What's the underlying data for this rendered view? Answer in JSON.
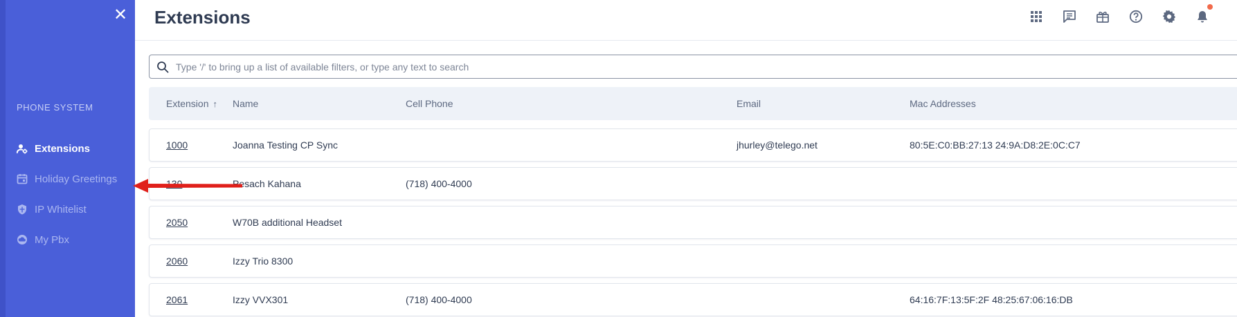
{
  "sidebar": {
    "close_glyph": "✕",
    "section_label": "PHONE SYSTEM",
    "items": [
      {
        "label": "Extensions",
        "icon": "person-gear-icon",
        "active": true
      },
      {
        "label": "Holiday Greetings",
        "icon": "calendar-icon",
        "active": false
      },
      {
        "label": "IP Whitelist",
        "icon": "shield-icon",
        "active": false
      },
      {
        "label": "My Pbx",
        "icon": "cloud-icon",
        "active": false
      }
    ]
  },
  "header": {
    "title": "Extensions",
    "icons": [
      "apps-grid-icon",
      "chat-icon",
      "gift-icon",
      "help-icon",
      "gear-icon",
      "bell-icon"
    ]
  },
  "search": {
    "placeholder": "Type '/' to bring up a list of available filters, or type any text to search",
    "value": ""
  },
  "table": {
    "columns": [
      "Extension",
      "Name",
      "Cell Phone",
      "Email",
      "Mac Addresses"
    ],
    "sort_indicator": "↑",
    "rows": [
      {
        "extension": "1000",
        "name": "Joanna Testing CP Sync",
        "cell_phone": "",
        "email": "jhurley@telego.net",
        "mac": "80:5E:C0:BB:27:13 24:9A:D8:2E:0C:C7"
      },
      {
        "extension": "130",
        "name": "Pesach Kahana",
        "cell_phone": "(718) 400-4000",
        "email": "",
        "mac": ""
      },
      {
        "extension": "2050",
        "name": "W70B additional Headset",
        "cell_phone": "",
        "email": "",
        "mac": ""
      },
      {
        "extension": "2060",
        "name": "Izzy Trio 8300",
        "cell_phone": "",
        "email": "",
        "mac": ""
      },
      {
        "extension": "2061",
        "name": "Izzy VVX301",
        "cell_phone": "(718) 400-4000",
        "email": "",
        "mac": "64:16:7F:13:5F:2F 48:25:67:06:16:DB"
      }
    ]
  },
  "colors": {
    "sidebar_bg": "#4a5fd9",
    "accent_red": "#e0201b",
    "notification_dot": "#f26a4b"
  }
}
